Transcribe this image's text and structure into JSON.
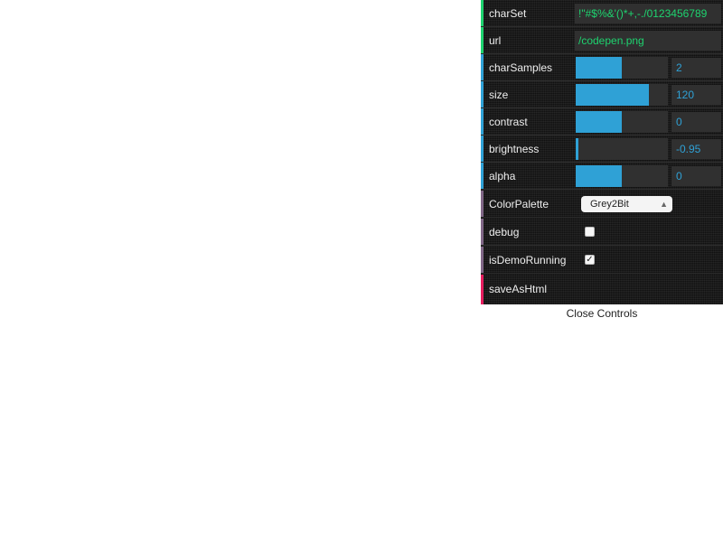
{
  "colors": {
    "panel_bg": "#1a1a1a",
    "slider_accent": "#2fa1d6",
    "string_value": "#1ed36f",
    "stripe_string": "#1ed36f",
    "stripe_number": "#2fa1d6",
    "stripe_option": "#806787",
    "stripe_boolean": "#806787",
    "stripe_function": "#e61d5f"
  },
  "controls": [
    {
      "id": "charSet",
      "label": "charSet",
      "type": "string",
      "value": "!\"#$%&'()*+,-./0123456789"
    },
    {
      "id": "url",
      "label": "url",
      "type": "string",
      "value": "/codepen.png"
    },
    {
      "id": "charSamples",
      "label": "charSamples",
      "type": "number",
      "value": "2",
      "fill": 0.5
    },
    {
      "id": "size",
      "label": "size",
      "type": "number",
      "value": "120",
      "fill": 0.79
    },
    {
      "id": "contrast",
      "label": "contrast",
      "type": "number",
      "value": "0",
      "fill": 0.5
    },
    {
      "id": "brightness",
      "label": "brightness",
      "type": "number",
      "value": "-0.95",
      "fill": 0.025
    },
    {
      "id": "alpha",
      "label": "alpha",
      "type": "number",
      "value": "0",
      "fill": 0.5
    },
    {
      "id": "colorPalette",
      "label": "ColorPalette",
      "type": "option",
      "value": "Grey2Bit",
      "icon": "updown-arrows-icon"
    },
    {
      "id": "debug",
      "label": "debug",
      "type": "boolean",
      "checked": false
    },
    {
      "id": "isDemoRunning",
      "label": "isDemoRunning",
      "type": "boolean",
      "checked": true,
      "icon": "checkmark-icon"
    },
    {
      "id": "saveAsHtml",
      "label": "saveAsHtml",
      "type": "function"
    }
  ],
  "footer": {
    "close_label": "Close Controls"
  }
}
